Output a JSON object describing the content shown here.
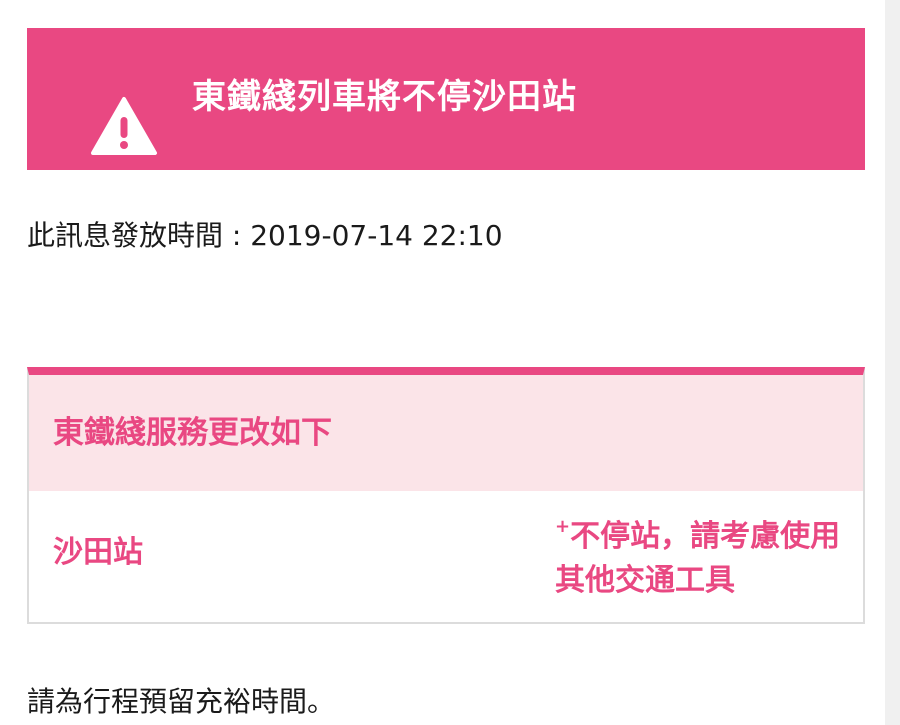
{
  "alert": {
    "title": "東鐵綫列車將不停沙田站",
    "icon": "warning-icon",
    "color": "#e94882"
  },
  "issue_time": {
    "text": "此訊息發放時間 : 2019-07-14 22:10"
  },
  "service_card": {
    "header_title": "東鐵綫服務更改如下",
    "header_bg": "#fbe4e8",
    "rows": [
      {
        "station": "沙田站",
        "note_marker": "+",
        "note": "不停站，請考慮使用其他交通工具"
      }
    ]
  },
  "footer": {
    "text": "請為行程預留充裕時間。"
  }
}
